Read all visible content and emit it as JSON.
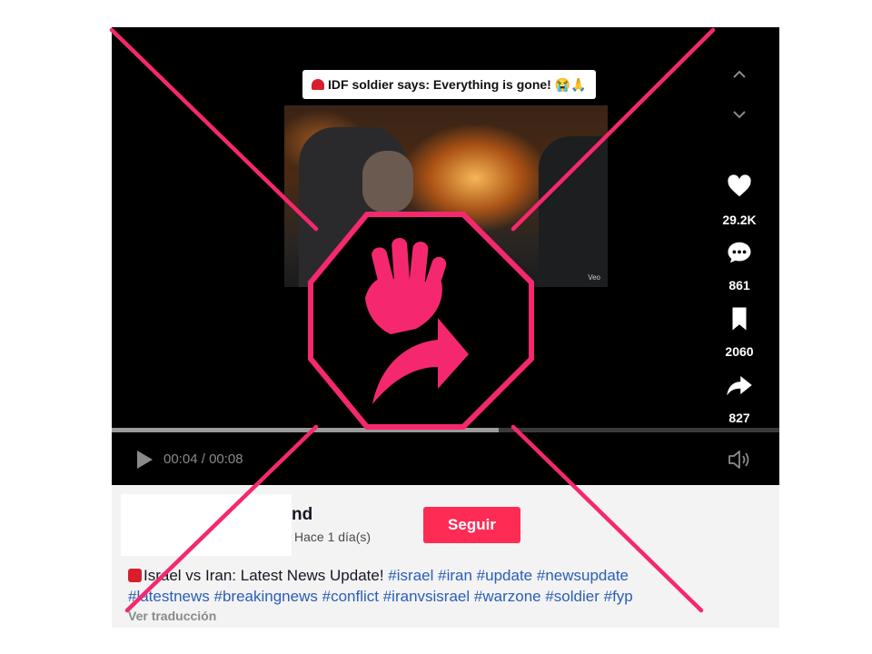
{
  "video": {
    "caption": "IDF soldier says: Everything is gone!",
    "caption_emojis": "😭🙏",
    "watermark": "Veo",
    "progress_fraction": 0.58,
    "current_time": "00:04",
    "duration": "00:08",
    "time_separator": " / "
  },
  "stats": {
    "likes": "29.2K",
    "comments": "861",
    "saves": "2060",
    "shares": "827"
  },
  "post": {
    "author_partial": "nd",
    "time_ago": "Hace 1 día(s)",
    "follow_label": "Seguir",
    "description_text": "Israel vs Iran: Latest News Update!",
    "hashtags": [
      "#israel",
      "#iran",
      "#update",
      "#newsupdate",
      "#latestnews",
      "#breakingnews",
      "#conflict",
      "#iranvsisrael",
      "#warzone",
      "#soldier",
      "#fyp"
    ],
    "translate_label": "Ver traducción"
  },
  "colors": {
    "accent": "#fe2c55",
    "hashtag": "#2b5db9",
    "overlay_pink": "#f5286f"
  },
  "icons": {
    "siren": "siren-emoji-icon",
    "like": "heart-icon",
    "comment": "comment-icon",
    "save": "bookmark-icon",
    "share": "share-arrow-icon",
    "play": "play-icon",
    "volume": "volume-icon",
    "overlay": "stop-hand-share-icon"
  }
}
